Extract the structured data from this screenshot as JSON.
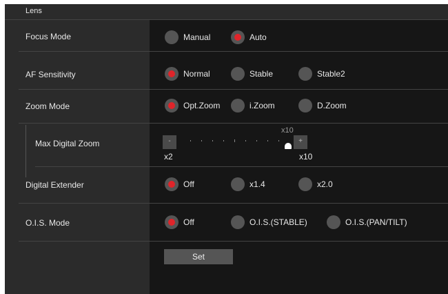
{
  "section": {
    "title": "Lens"
  },
  "focus_mode": {
    "label": "Focus Mode",
    "options": [
      "Manual",
      "Auto"
    ],
    "selected": "Auto"
  },
  "af_sensitivity": {
    "label": "AF Sensitivity",
    "options": [
      "Normal",
      "Stable",
      "Stable2"
    ],
    "selected": "Normal"
  },
  "zoom_mode": {
    "label": "Zoom Mode",
    "options": [
      "Opt.Zoom",
      "i.Zoom",
      "D.Zoom"
    ],
    "selected": "Opt.Zoom"
  },
  "max_digital_zoom": {
    "label": "Max Digital Zoom",
    "minus_label": "-",
    "plus_label": "+",
    "min_label": "x2",
    "max_label": "x10",
    "value_label": "x10",
    "value": 10,
    "min": 2,
    "max": 10
  },
  "digital_extender": {
    "label": "Digital Extender",
    "options": [
      "Off",
      "x1.4",
      "x2.0"
    ],
    "selected": "Off"
  },
  "ois_mode": {
    "label": "O.I.S. Mode",
    "options": [
      "Off",
      "O.I.S.(STABLE)",
      "O.I.S.(PAN/TILT)"
    ],
    "selected": "Off"
  },
  "set_button": {
    "label": "Set"
  },
  "colors": {
    "panel": "#161616",
    "label_column": "#2b2b2b",
    "radio_selected": "#e0242a",
    "radio_idle": "#555555"
  }
}
